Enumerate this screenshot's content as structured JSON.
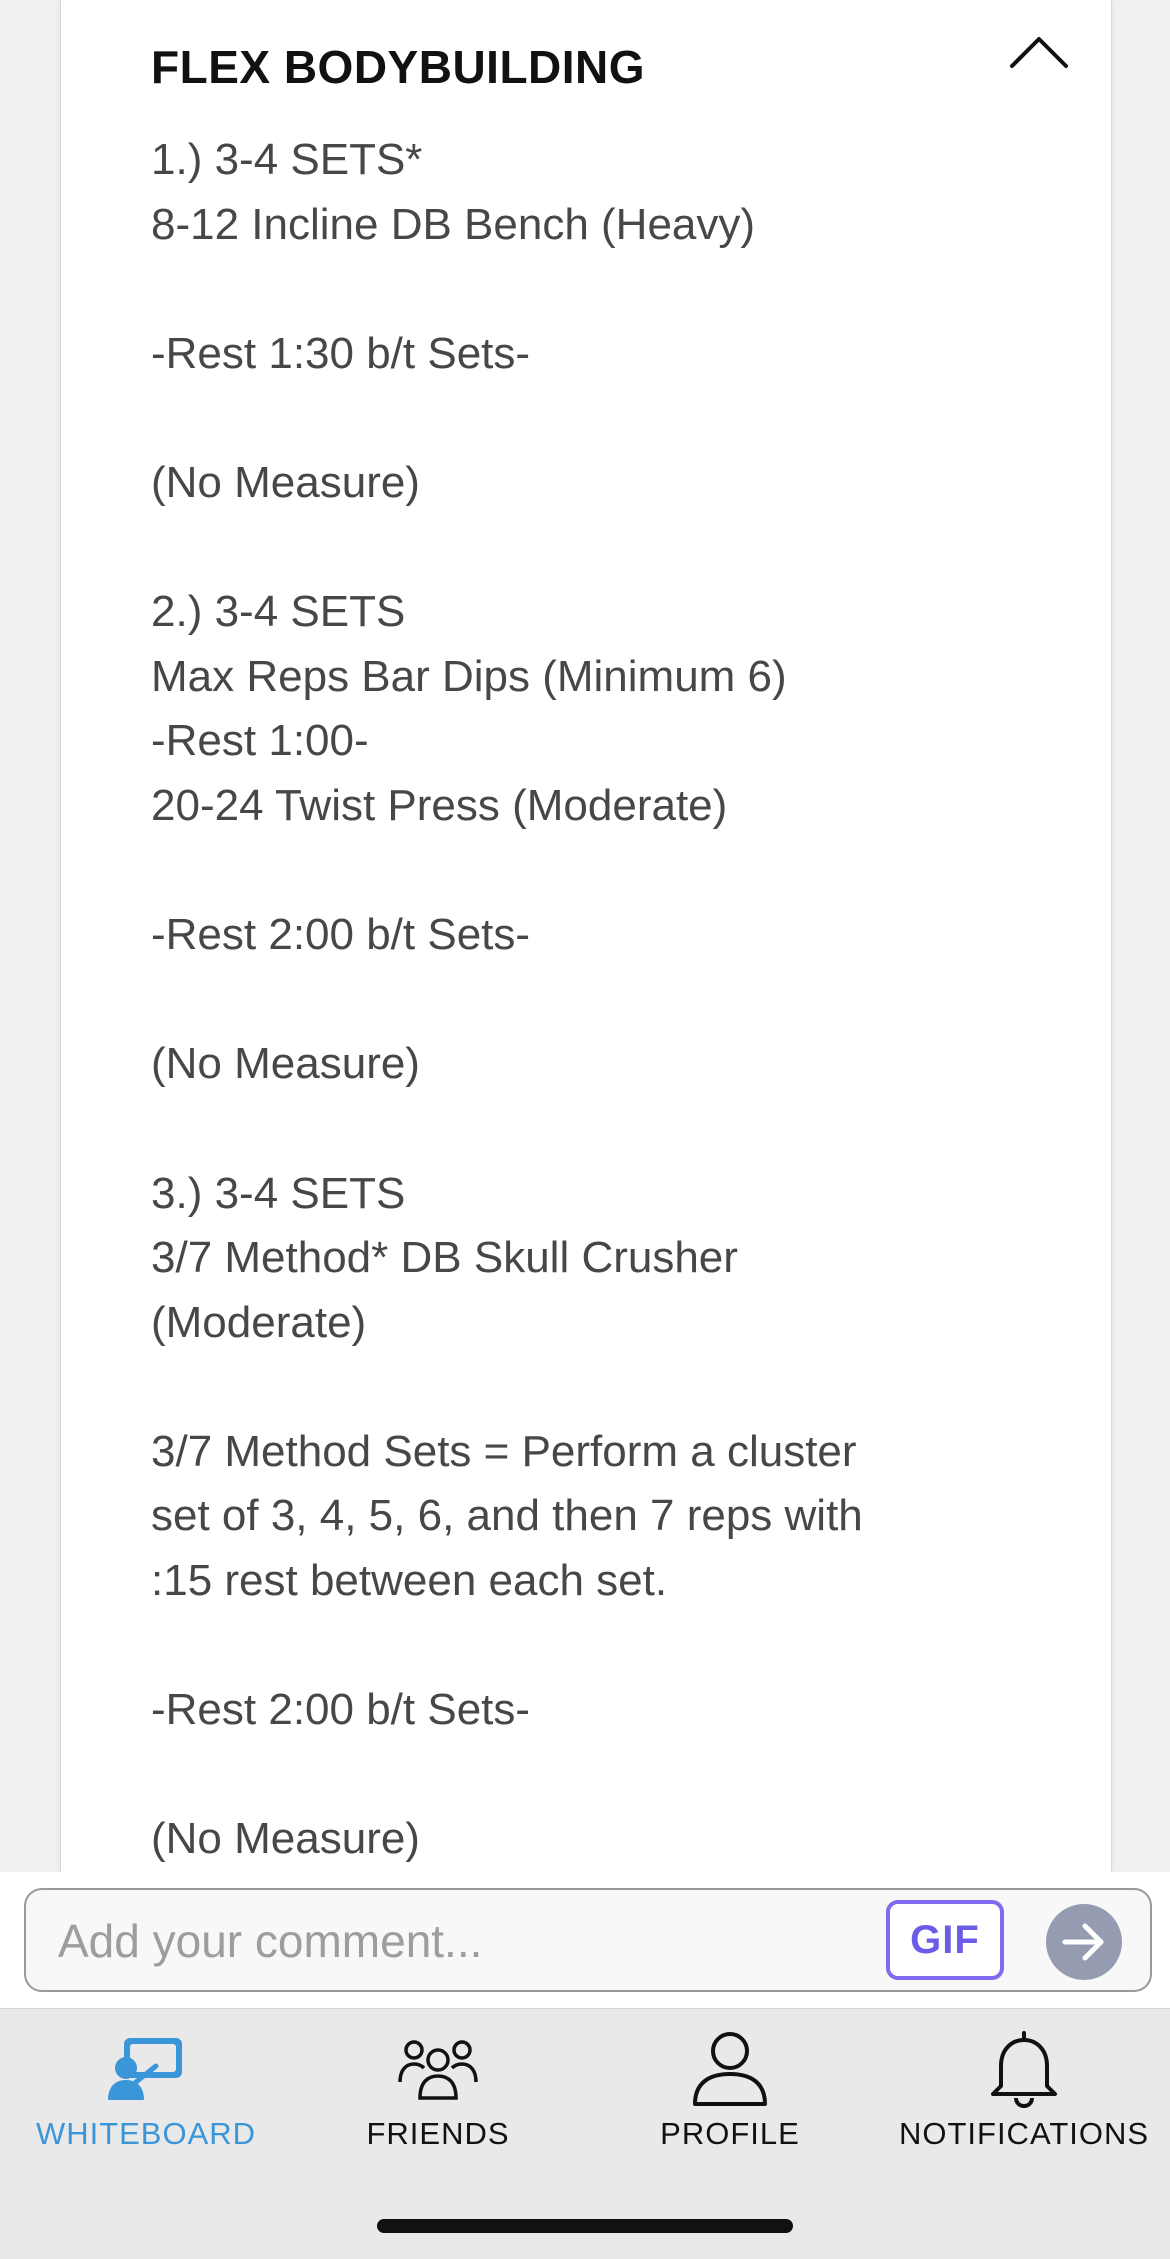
{
  "card": {
    "title": "FLEX BODYBUILDING",
    "body": "1.) 3-4 SETS*\n8-12 Incline DB Bench (Heavy)\n\n-Rest 1:30 b/t Sets-\n\n(No Measure)\n\n2.) 3-4 SETS\nMax Reps Bar Dips (Minimum 6)\n-Rest 1:00-\n20-24 Twist Press (Moderate)\n\n-Rest 2:00 b/t Sets-\n\n(No Measure)\n\n3.) 3-4 SETS\n3/7 Method* DB Skull Crusher\n(Moderate)\n\n3/7 Method Sets = Perform a cluster\nset of 3, 4, 5, 6, and then 7 reps with\n:15 rest between each set.\n\n-Rest 2:00 b/t Sets-\n\n(No Measure)",
    "collapse_icon": "chevron-up-icon"
  },
  "comment": {
    "placeholder": "Add your comment...",
    "gif_label": "GIF",
    "send_icon": "arrow-right-icon"
  },
  "tabs": [
    {
      "label": "WHITEBOARD",
      "icon": "whiteboard-icon",
      "active": true
    },
    {
      "label": "FRIENDS",
      "icon": "friends-icon",
      "active": false
    },
    {
      "label": "PROFILE",
      "icon": "profile-icon",
      "active": false
    },
    {
      "label": "NOTIFICATIONS",
      "icon": "bell-icon",
      "active": false
    }
  ],
  "colors": {
    "active_tab": "#3a95d9",
    "gif_accent": "#6b5ce7",
    "send_button": "#959cb1"
  }
}
